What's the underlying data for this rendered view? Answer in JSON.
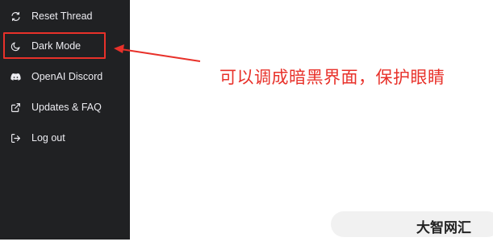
{
  "sidebar": {
    "items": [
      {
        "label": "Reset Thread",
        "icon": "refresh-icon"
      },
      {
        "label": "Dark Mode",
        "icon": "moon-icon"
      },
      {
        "label": "OpenAI Discord",
        "icon": "discord-icon"
      },
      {
        "label": "Updates & FAQ",
        "icon": "external-link-icon"
      },
      {
        "label": "Log out",
        "icon": "logout-icon"
      }
    ]
  },
  "annotation": {
    "text": "可以调成暗黑界面，保护眼睛",
    "color": "#e8312a"
  },
  "watermark": {
    "text": "大智网汇"
  },
  "colors": {
    "sidebar_bg": "#202123",
    "sidebar_text": "#ececf1",
    "annotation_red": "#e8312a"
  }
}
